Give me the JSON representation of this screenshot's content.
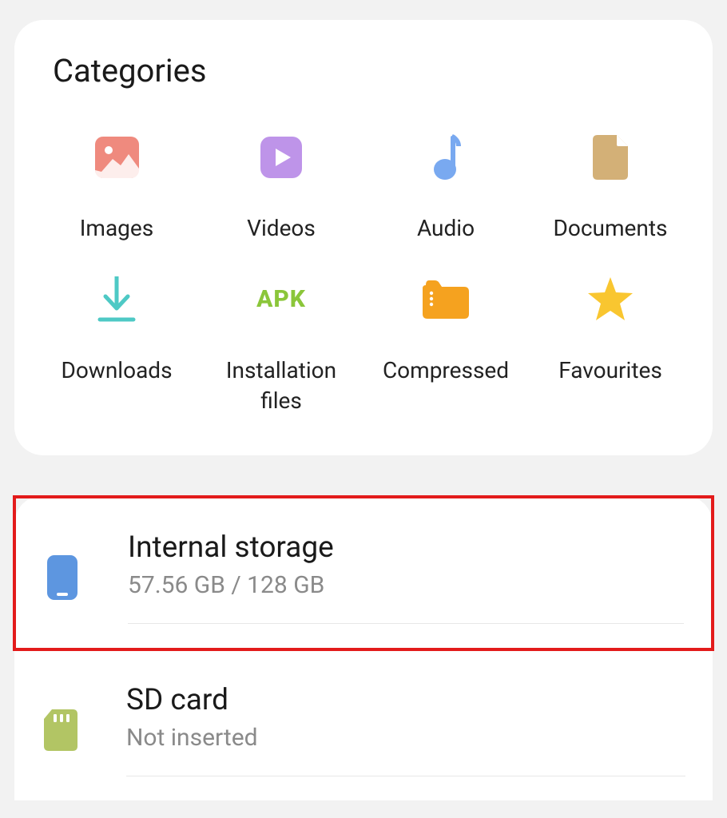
{
  "categories": {
    "title": "Categories",
    "items": [
      {
        "label": "Images"
      },
      {
        "label": "Videos"
      },
      {
        "label": "Audio"
      },
      {
        "label": "Documents"
      },
      {
        "label": "Downloads"
      },
      {
        "label": "Installation files",
        "icon_text": "APK"
      },
      {
        "label": "Compressed"
      },
      {
        "label": "Favourites"
      }
    ]
  },
  "storage": {
    "internal": {
      "title": "Internal storage",
      "subtitle": "57.56 GB / 128 GB"
    },
    "sd": {
      "title": "SD card",
      "subtitle": "Not inserted"
    }
  }
}
